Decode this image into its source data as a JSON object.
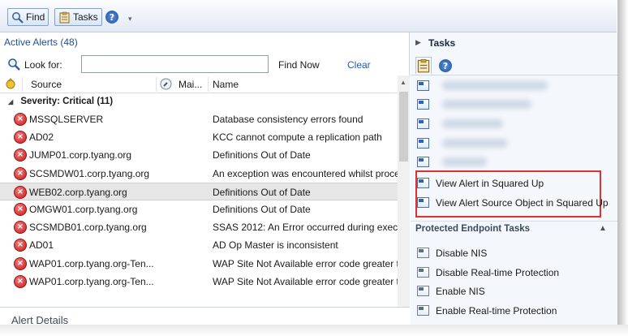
{
  "toolbar": {
    "find_label": "Find",
    "tasks_label": "Tasks",
    "dropdown_glyph": "▾"
  },
  "alerts": {
    "title": "Active Alerts (48)",
    "look_for_label": "Look for:",
    "search_value": "",
    "find_now_label": "Find Now",
    "clear_label": "Clear",
    "columns": {
      "source": "Source",
      "maintenance": "Mai...",
      "name": "Name"
    },
    "group_label": "Severity: Critical (11)",
    "rows": [
      {
        "source": "MSSQLSERVER",
        "name": "Database consistency errors found"
      },
      {
        "source": "AD02",
        "name": "KCC cannot compute a replication path"
      },
      {
        "source": "JUMP01.corp.tyang.org",
        "name": "Definitions Out of Date"
      },
      {
        "source": "SCSMDW01.corp.tyang.org",
        "name": "An exception was encountered whilst proce"
      },
      {
        "source": "WEB02.corp.tyang.org",
        "name": "Definitions Out of Date",
        "selected": true
      },
      {
        "source": "OMGW01.corp.tyang.org",
        "name": "Definitions Out of Date"
      },
      {
        "source": "SCSMDB01.corp.tyang.org",
        "name": "SSAS 2012: An Error occurred during execut"
      },
      {
        "source": "AD01",
        "name": "AD Op Master is inconsistent"
      },
      {
        "source": "WAP01.corp.tyang.org-Ten...",
        "name": "WAP Site Not Available error code greater t"
      },
      {
        "source": "WAP01.corp.tyang.org-Ten...",
        "name": "WAP Site Not Available error code greater t"
      }
    ],
    "details_title": "Alert Details"
  },
  "tasks": {
    "title": "Tasks",
    "squared_up": [
      "View Alert in Squared Up",
      "View Alert Source Object in Squared Up"
    ],
    "endpoint_section_title": "Protected Endpoint Tasks",
    "endpoint_items": [
      "Disable NIS",
      "Disable Real-time Protection",
      "Enable NIS",
      "Enable Real-time Protection"
    ]
  },
  "colors": {
    "accent_title": "#1f4e97",
    "link": "#1f5cb8",
    "critical": "#c81818",
    "highlight_box": "#e03030"
  }
}
